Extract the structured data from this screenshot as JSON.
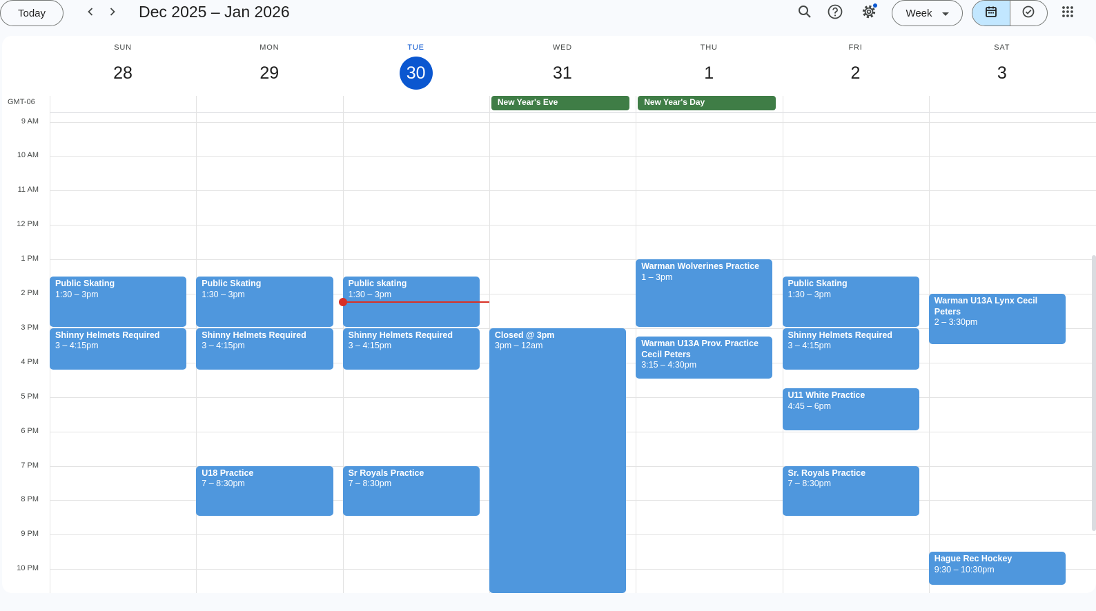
{
  "toolbar": {
    "today_label": "Today",
    "prev_icon": "chevron-left-icon",
    "next_icon": "chevron-right-icon",
    "range_title": "Dec 2025 – Jan 2026",
    "view_label": "Week",
    "icons": [
      "search-icon",
      "help-icon",
      "settings-icon",
      "calendar-icon",
      "tasks-icon",
      "apps-grid-icon"
    ],
    "accent_color": "#0b57d0"
  },
  "timezone_label": "GMT-06",
  "days": [
    {
      "dow": "SUN",
      "num": "28"
    },
    {
      "dow": "MON",
      "num": "29"
    },
    {
      "dow": "TUE",
      "num": "30",
      "today": true
    },
    {
      "dow": "WED",
      "num": "31"
    },
    {
      "dow": "THU",
      "num": "1"
    },
    {
      "dow": "FRI",
      "num": "2"
    },
    {
      "dow": "SAT",
      "num": "3"
    }
  ],
  "hours": [
    "9 AM",
    "10 AM",
    "11 AM",
    "12 PM",
    "1 PM",
    "2 PM",
    "3 PM",
    "4 PM",
    "5 PM",
    "6 PM",
    "7 PM",
    "8 PM",
    "9 PM",
    "10 PM"
  ],
  "all_day_events": [
    {
      "day": 3,
      "title": "New Year's Eve",
      "color": "#3f7d46"
    },
    {
      "day": 4,
      "title": "New Year's Day",
      "color": "#3f7d46"
    }
  ],
  "events": [
    {
      "day": 0,
      "title": "Public Skating",
      "time": "1:30 – 3pm",
      "start": 13.5,
      "end": 15
    },
    {
      "day": 0,
      "title": "Shinny Helmets Required",
      "time": "3 – 4:15pm",
      "start": 15,
      "end": 16.25
    },
    {
      "day": 1,
      "title": "Public Skating",
      "time": "1:30 – 3pm",
      "start": 13.5,
      "end": 15
    },
    {
      "day": 1,
      "title": "Shinny Helmets Required",
      "time": "3 – 4:15pm",
      "start": 15,
      "end": 16.25
    },
    {
      "day": 1,
      "title": "U18 Practice",
      "time": "7 – 8:30pm",
      "start": 19,
      "end": 20.5
    },
    {
      "day": 2,
      "title": "Public skating",
      "time": "1:30 – 3pm",
      "start": 13.5,
      "end": 15
    },
    {
      "day": 2,
      "title": "Shinny Helmets Required",
      "time": "3 – 4:15pm",
      "start": 15,
      "end": 16.25
    },
    {
      "day": 2,
      "title": "Sr Royals Practice",
      "time": "7 – 8:30pm",
      "start": 19,
      "end": 20.5
    },
    {
      "day": 3,
      "title": "Closed @ 3pm",
      "time": "3pm – 12am",
      "start": 15,
      "end": 24
    },
    {
      "day": 4,
      "title": "Warman Wolverines Practice",
      "time": "1 – 3pm",
      "start": 13,
      "end": 15
    },
    {
      "day": 4,
      "title": "Warman U13A Prov. Practice Cecil Peters",
      "time": "3:15 – 4:30pm",
      "start": 15.25,
      "end": 16.5
    },
    {
      "day": 5,
      "title": "Public Skating",
      "time": "1:30 – 3pm",
      "start": 13.5,
      "end": 15
    },
    {
      "day": 5,
      "title": "Shinny Helmets Required",
      "time": "3 – 4:15pm",
      "start": 15,
      "end": 16.25
    },
    {
      "day": 5,
      "title": "U11 White Practice",
      "time": "4:45 – 6pm",
      "start": 16.75,
      "end": 18
    },
    {
      "day": 5,
      "title": "Sr. Royals Practice",
      "time": "7 – 8:30pm",
      "start": 19,
      "end": 20.5
    },
    {
      "day": 6,
      "title": "Warman U13A Lynx Cecil Peters",
      "time": "2 – 3:30pm",
      "start": 14,
      "end": 15.5
    },
    {
      "day": 6,
      "title": "Hague Rec Hockey",
      "time": "9:30 – 10:30pm",
      "start": 21.5,
      "end": 22.5
    }
  ],
  "event_color": "#4f97dd",
  "current_time": {
    "day": 2,
    "hour": 14.25,
    "color": "#d93025"
  }
}
